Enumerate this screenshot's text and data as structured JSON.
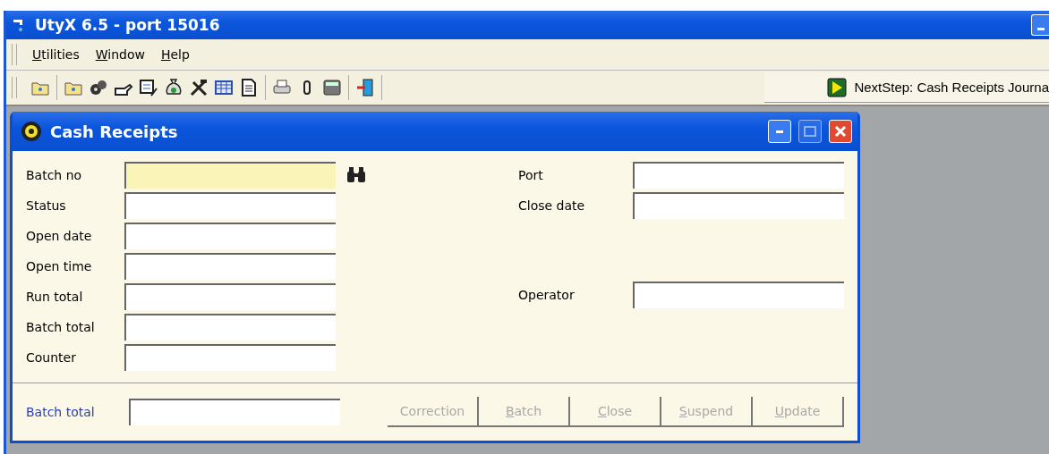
{
  "window": {
    "title": "UtyX 6.5 - port 15016"
  },
  "menu": [
    {
      "label": "Utilities",
      "mnemonic": true
    },
    {
      "label": "Window",
      "mnemonic": true
    },
    {
      "label": "Help",
      "mnemonic": true
    }
  ],
  "next_step": {
    "label": "NextStep: Cash Receipts Journa"
  },
  "dialog": {
    "title": "Cash Receipts",
    "left_fields": [
      {
        "label": "Batch no",
        "highlighted": true
      },
      {
        "label": "Status",
        "highlighted": false
      },
      {
        "label": "Open date",
        "highlighted": false
      },
      {
        "label": "Open time",
        "highlighted": false
      },
      {
        "label": "Run total",
        "highlighted": false
      },
      {
        "label": "Batch total",
        "highlighted": false
      },
      {
        "label": "Counter",
        "highlighted": false
      }
    ],
    "right_fields": [
      {
        "label": "Port",
        "kind": "field"
      },
      {
        "label": "Close date",
        "kind": "field"
      },
      {
        "label": "Operator",
        "kind": "detached"
      }
    ],
    "footer_field": {
      "label": "Batch total"
    },
    "buttons": [
      {
        "label": "Correction",
        "disabled": true,
        "mnemonic": false
      },
      {
        "label": "Batch",
        "disabled": true,
        "mnemonic": true
      },
      {
        "label": "Close",
        "disabled": true,
        "mnemonic": true
      },
      {
        "label": "Suspend",
        "disabled": true,
        "mnemonic": true
      },
      {
        "label": "Update",
        "disabled": true,
        "mnemonic": true
      }
    ]
  }
}
